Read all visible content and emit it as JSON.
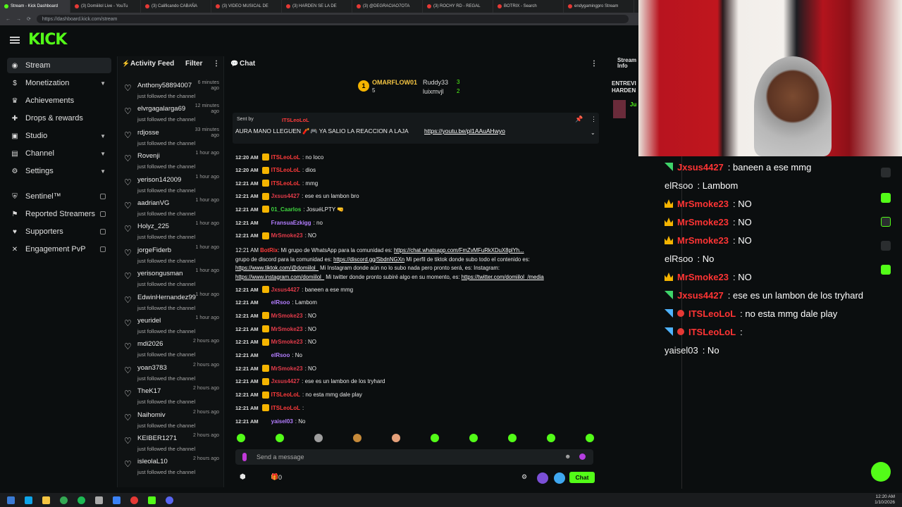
{
  "browser": {
    "tabs": [
      "Stream - Kick Dashboard",
      "(3) Domiiilol Live - YouTu",
      "(3) Calificando CABAÑA",
      "(3) VIDEO MUSICAL DE",
      "(3) HARDEN SE LA DE",
      "(3) @DEGRACIAO7OTA",
      "(3) ROCHY RD - REGAL",
      "BOTRIX - Search",
      "endygamingpro Stream"
    ],
    "url": "https://dashboard.kick.com/stream"
  },
  "brand": {
    "logo": "KICK",
    "accent": "#53fc18"
  },
  "sidebar": {
    "items": [
      {
        "label": "Stream",
        "icon": "stream-icon",
        "chevron": false
      },
      {
        "label": "Monetization",
        "icon": "dollar-icon",
        "chevron": true
      },
      {
        "label": "Achievements",
        "icon": "trophy-icon",
        "chevron": false
      },
      {
        "label": "Drops & rewards",
        "icon": "gift-icon",
        "chevron": false
      },
      {
        "label": "Studio",
        "icon": "studio-icon",
        "chevron": true
      },
      {
        "label": "Channel",
        "icon": "channel-icon",
        "chevron": true
      },
      {
        "label": "Settings",
        "icon": "gear-icon",
        "chevron": true
      },
      {
        "label": "Sentinel™",
        "icon": "shield-icon",
        "lock": true
      },
      {
        "label": "Reported Streamers",
        "icon": "flag-icon",
        "lock": true
      },
      {
        "label": "Supporters",
        "icon": "users-icon",
        "lock": true
      },
      {
        "label": "Engagement PvP",
        "icon": "swords-icon",
        "lock": true
      }
    ]
  },
  "feed": {
    "title": "Activity Feed",
    "filter": "Filter",
    "sub": "just followed the channel",
    "items": [
      {
        "name": "Anthony58894007",
        "time": "6 minutes ago"
      },
      {
        "name": "elvrgagalarga69",
        "time": "12 minutes ago"
      },
      {
        "name": "rdjosse",
        "time": "33 minutes ago"
      },
      {
        "name": "Rovenji",
        "time": "1 hour ago"
      },
      {
        "name": "yerison142009",
        "time": "1 hour ago"
      },
      {
        "name": "aadrianVG",
        "time": "1 hour ago"
      },
      {
        "name": "Holyz_225",
        "time": "1 hour ago"
      },
      {
        "name": "jorgeFiderb",
        "time": "1 hour ago"
      },
      {
        "name": "yerisongusman",
        "time": "1 hour ago"
      },
      {
        "name": "EdwinHernandez99",
        "time": "1 hour ago"
      },
      {
        "name": "yeuridel",
        "time": "1 hour ago"
      },
      {
        "name": "mdi2026",
        "time": "2 hours ago"
      },
      {
        "name": "yoan3783",
        "time": "2 hours ago"
      },
      {
        "name": "TheK17",
        "time": "2 hours ago"
      },
      {
        "name": "Naihomiv",
        "time": "2 hours ago"
      },
      {
        "name": "KEIBER1271",
        "time": "2 hours ago"
      },
      {
        "name": "isleolaL10",
        "time": "2 hours ago"
      }
    ]
  },
  "chat": {
    "title": "Chat",
    "leaderboard": {
      "first": {
        "rank": "1",
        "name": "OMARFLOW01",
        "count": "5"
      },
      "second": {
        "name": "Ruddy33",
        "count": "3"
      },
      "third": {
        "name": "luixmvjl",
        "count": "2"
      }
    },
    "pinned": {
      "sent_by": "Sent by",
      "user": "ITSLeoLoL",
      "text": "AURA MANO LLEGUEN 🧨🎮 YA SALIO LA REACCION A LAJA",
      "link": "https://youtu.be/pl1AAuAHwyo"
    },
    "messages": [
      {
        "time": "12:20 AM",
        "user": "ITSLeoLoL",
        "color": "#ff3b3b",
        "text": ": no loco"
      },
      {
        "time": "12:20 AM",
        "user": "ITSLeoLoL",
        "color": "#ff3b3b",
        "text": ": dios"
      },
      {
        "time": "12:21 AM",
        "user": "ITSLeoLoL",
        "color": "#ff3b3b",
        "text": ": mmg"
      },
      {
        "time": "12:21 AM",
        "user": "Jxsus4427",
        "color": "#e23b4a",
        "text": ": ese es un lambon bro"
      },
      {
        "time": "12:21 AM",
        "user": "01_Caarlos",
        "color": "#3fd43f",
        "text": ": JosuéLPTY 🤜"
      },
      {
        "time": "12:21 AM",
        "user": "FransuaEzkigg",
        "color": "#b37dff",
        "text": ": no"
      },
      {
        "time": "12:21 AM",
        "user": "MrSmoke23",
        "color": "#e23b4a",
        "text": ": NO"
      }
    ],
    "botrix": {
      "time": "12:21 AM",
      "user": "BotRix",
      "line1": ": Mi grupo de WhatsApp para la comunidad es:",
      "link1": "https://chat.whatsapp.com/FmZvMFuRkXDuX8plYh...",
      "line2a": "grupo de discord para la comunidad es:",
      "link2": "https://discord.gg/SbdnNGXn",
      "line2b": "Mi perfil de tiktok donde subo todo el contenido es:",
      "link3": "https://www.tiktok.com/@domiilol_",
      "line3": "Mi Instagram donde aún no lo subo nada pero pronto será, es: Instagram:",
      "link4": "https://www.instagram.com/domiilol_",
      "line4": "Mi twitter donde pronto subiré algo en su momento, es:",
      "link5": "https://twitter.com/domiilol_/media"
    },
    "messages2": [
      {
        "time": "12:21 AM",
        "user": "Jxsus4427",
        "color": "#e23b4a",
        "text": ": baneen a ese mmg"
      },
      {
        "time": "12:21 AM",
        "user": "elRsoo",
        "color": "#b37dff",
        "text": ": Lambom"
      },
      {
        "time": "12:21 AM",
        "user": "MrSmoke23",
        "color": "#e23b4a",
        "text": ": NO"
      },
      {
        "time": "12:21 AM",
        "user": "MrSmoke23",
        "color": "#e23b4a",
        "text": ": NO"
      },
      {
        "time": "12:21 AM",
        "user": "MrSmoke23",
        "color": "#e23b4a",
        "text": ": NO"
      },
      {
        "time": "12:21 AM",
        "user": "elRsoo",
        "color": "#b37dff",
        "text": ": No"
      },
      {
        "time": "12:21 AM",
        "user": "MrSmoke23",
        "color": "#e23b4a",
        "text": ": NO"
      },
      {
        "time": "12:21 AM",
        "user": "Jxsus4427",
        "color": "#e23b4a",
        "text": ": ese es un lambon de los tryhard"
      },
      {
        "time": "12:21 AM",
        "user": "ITSLeoLoL",
        "color": "#ff3b3b",
        "text": ": no esta mmg dale play"
      },
      {
        "time": "12:21 AM",
        "user": "ITSLeoLoL",
        "color": "#ff3b3b",
        "text": ":"
      },
      {
        "time": "12:21 AM",
        "user": "yaisel03",
        "color": "#b37dff",
        "text": ": No"
      }
    ],
    "input_placeholder": "Send a message",
    "points": "0",
    "send_label": "Chat"
  },
  "stream_info": {
    "title": "Stream Info",
    "snippet": "ENTREVI HARDEN",
    "user": "Ju"
  },
  "overlay": {
    "lines": [
      {
        "name": "Jxsus4427",
        "text": ": baneen a ese mmg",
        "badge": "sub"
      },
      {
        "name": "elRsoo",
        "text": ": Lambom",
        "badge": "none"
      },
      {
        "name": "MrSmoke23",
        "text": ": NO",
        "badge": "crown"
      },
      {
        "name": "MrSmoke23",
        "text": ": NO",
        "badge": "crown"
      },
      {
        "name": "MrSmoke23",
        "text": ": NO",
        "badge": "crown"
      },
      {
        "name": "elRsoo",
        "text": ": No",
        "badge": "none"
      },
      {
        "name": "MrSmoke23",
        "text": ": NO",
        "badge": "crown"
      },
      {
        "name": "Jxsus4427",
        "text": ": ese es un lambon de los tryhard",
        "badge": "sub"
      },
      {
        "name": "ITSLeoLoL",
        "text": ": no esta mmg dale play",
        "badge": "mod"
      },
      {
        "name": "ITSLeoLoL",
        "text": ":",
        "badge": "mod"
      },
      {
        "name": "yaisel03",
        "text": ": No",
        "badge": "none"
      }
    ]
  },
  "taskbar": {
    "time": "12:20 AM",
    "date": "1/10/2026"
  }
}
